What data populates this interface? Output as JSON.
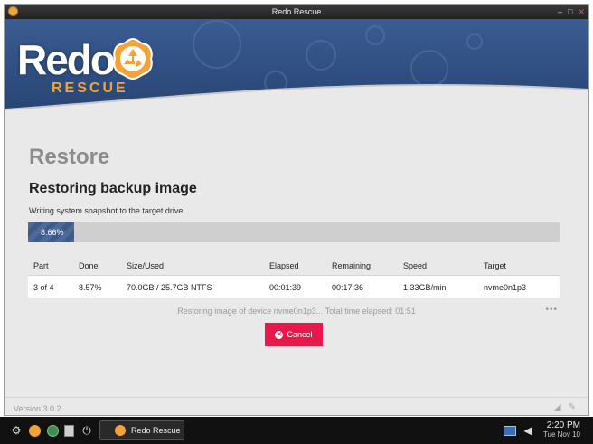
{
  "window": {
    "title": "Redo Rescue",
    "controls": {
      "minimize": "–",
      "maximize": "□",
      "close": "✕"
    }
  },
  "logo": {
    "word": "Redo",
    "sub": "RESCUE"
  },
  "page": {
    "heading": "Restore",
    "subheading": "Restoring backup image",
    "description": "Writing system snapshot to the target drive."
  },
  "progress": {
    "label": "8.66%",
    "fraction": 0.0866
  },
  "table": {
    "headers": [
      "Part",
      "Done",
      "Size/Used",
      "Elapsed",
      "Remaining",
      "Speed",
      "Target"
    ],
    "row": [
      "3 of 4",
      "8.57%",
      "70.0GB / 25.7GB NTFS",
      "00:01:39",
      "00:17:36",
      "1.33GB/min",
      "nvme0n1p3"
    ]
  },
  "status": {
    "text": "Restoring image of device nvme0n1p3... Total time elapsed: 01:51",
    "more": "•••"
  },
  "actions": {
    "cancel_label": "Cancel"
  },
  "footer": {
    "version": "Version 3.0.2"
  },
  "taskbar": {
    "icons": [
      "gear-icon",
      "redo-icon",
      "globe-icon",
      "files-icon",
      "power-icon"
    ],
    "task_label": "Redo Rescue",
    "time": "2:20 PM",
    "date": "Tue Nov 10"
  },
  "colors": {
    "accent": "#e8194a",
    "banner": "#2d4a7a",
    "progress": "#4d6a99",
    "logo_orange": "#f2a33a"
  }
}
